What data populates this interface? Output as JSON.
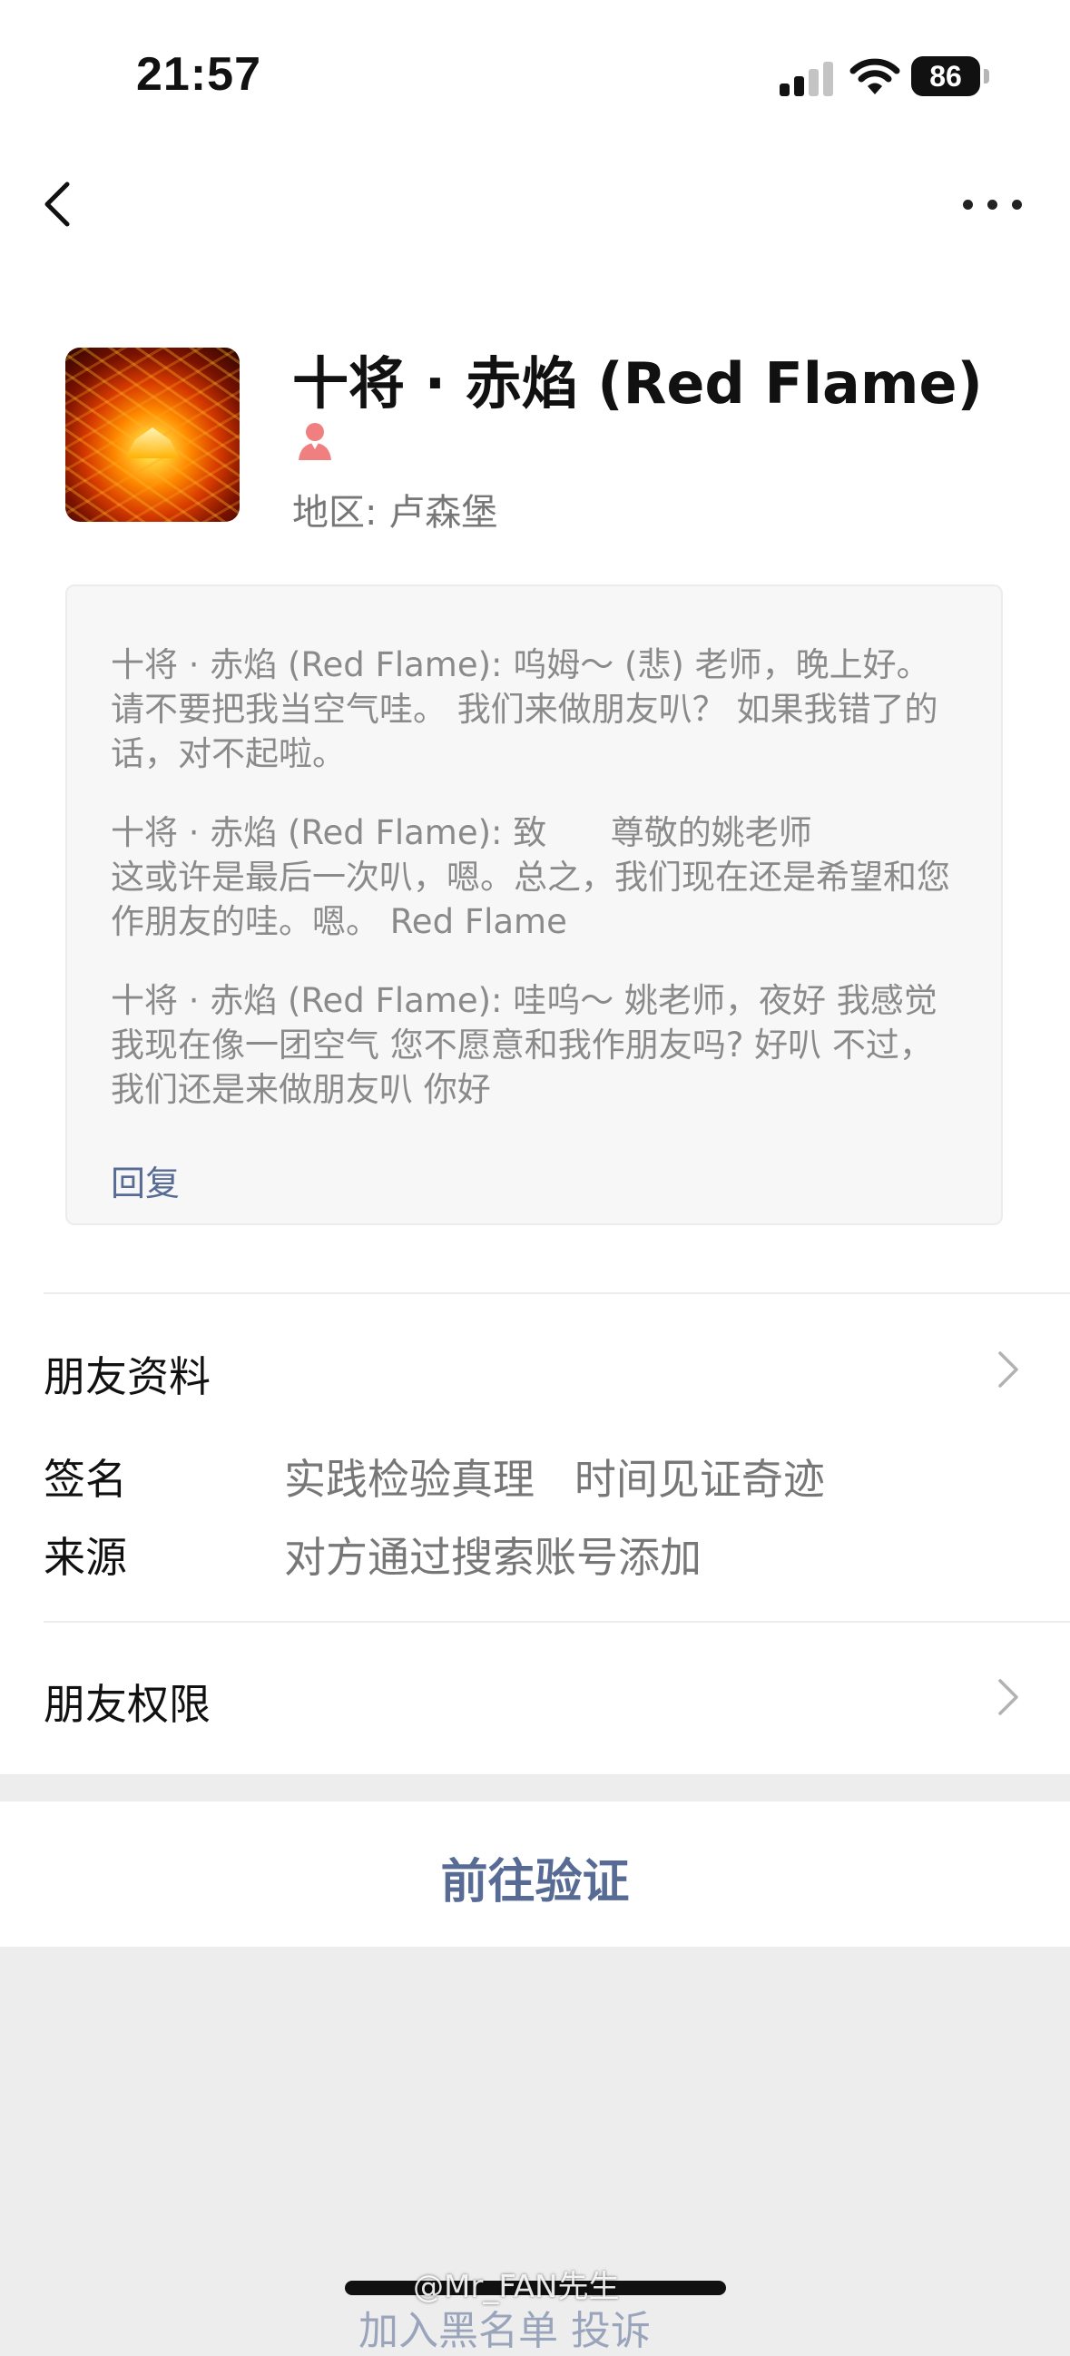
{
  "status_bar": {
    "time": "21:57",
    "battery": "86"
  },
  "nav": {
    "back_icon": "chevron-left-icon",
    "more_icon": "more-dots-icon"
  },
  "profile": {
    "name": "十将 · 赤焰 (Red Flame)",
    "gender_icon": "female-user-icon",
    "region": "地区: 卢森堡"
  },
  "messages": [
    "十将 · 赤焰 (Red Flame): 呜姆～ (悲) 老师，晚上好。 请不要把我当空气哇。 我们来做朋友叭？ 如果我错了的话，对不起啦。",
    "十将 · 赤焰 (Red Flame): 致      尊敬的姚老师\n这或许是最后一次叭，嗯。总之，我们现在还是希望和您作朋友的哇。嗯。 Red Flame",
    "十将 · 赤焰 (Red Flame): 哇呜～ 姚老师，夜好 我感觉我现在像一团空气 您不愿意和我作朋友吗? 好叭 不过，我们还是来做朋友叭 你好"
  ],
  "reply_label": "回复",
  "info": {
    "friend_profile": "朋友资料",
    "signature_label": "签名",
    "signature_value": "实践检验真理   时间见证奇迹",
    "source_label": "来源",
    "source_value": "对方通过搜索账号添加",
    "friend_permissions": "朋友权限"
  },
  "verify_button": "前往验证",
  "watermark": "@Mr_FAN先生",
  "bottom_partial_text": "加入黑名单 投诉",
  "colors": {
    "link": "#576b95",
    "background": "#ededed",
    "accent_female": "#f08080"
  }
}
